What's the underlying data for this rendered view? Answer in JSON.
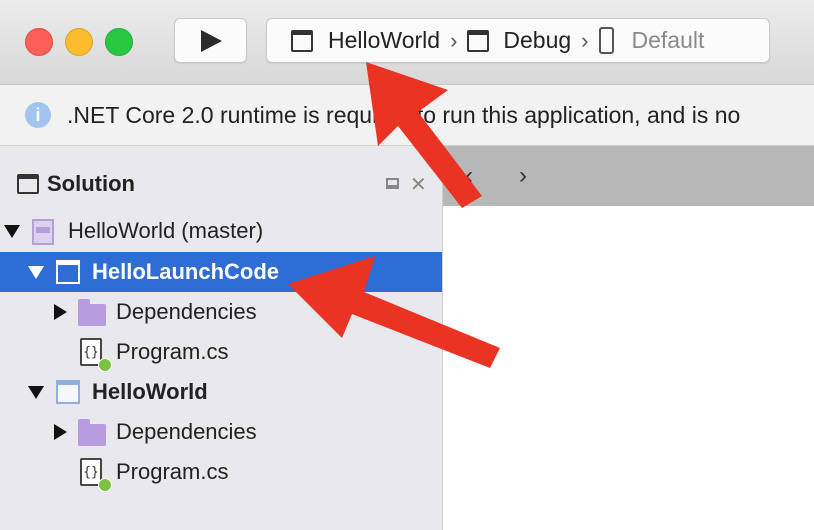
{
  "toolbar": {
    "run_icon": "play-icon",
    "scheme": {
      "project": "HelloWorld",
      "configuration": "Debug",
      "device": "Default"
    }
  },
  "infobar": {
    "icon": "info-icon",
    "message": ".NET Core 2.0 runtime is required to run this application, and is no"
  },
  "solution_pad": {
    "title": "Solution",
    "tree": [
      {
        "label": "HelloWorld (master)",
        "icon": "solution-icon"
      },
      {
        "label": "HelloLaunchCode",
        "icon": "project-icon",
        "selected": true
      },
      {
        "label": "Dependencies",
        "icon": "folder-icon"
      },
      {
        "label": "Program.cs",
        "icon": "csharp-file-icon",
        "glyph": "{}"
      },
      {
        "label": "HelloWorld",
        "icon": "project-icon"
      },
      {
        "label": "Dependencies",
        "icon": "folder-icon"
      },
      {
        "label": "Program.cs",
        "icon": "csharp-file-icon",
        "glyph": "{}"
      }
    ]
  },
  "editor": {
    "back": "‹",
    "forward": "›"
  },
  "colors": {
    "selection": "#2e6cd6",
    "annotation_arrow": "#ea3323"
  }
}
